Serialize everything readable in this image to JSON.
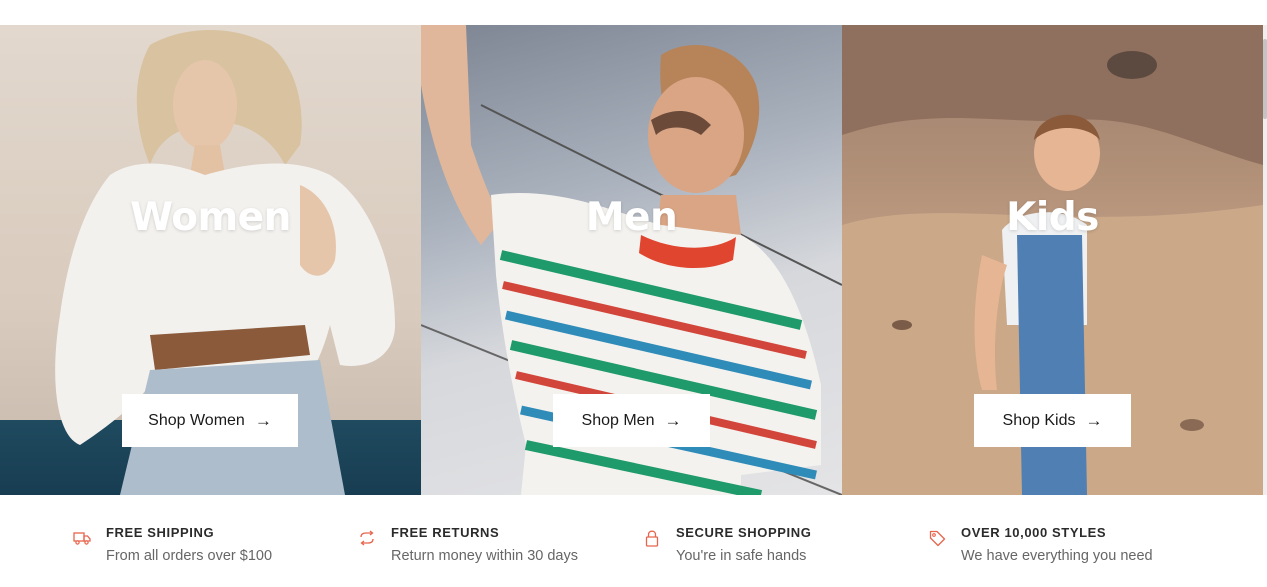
{
  "categories": [
    {
      "title": "Women",
      "button_label": "Shop Women",
      "arrow": "→"
    },
    {
      "title": "Men",
      "button_label": "Shop Men",
      "arrow": "→"
    },
    {
      "title": "Kids",
      "button_label": "Shop Kids",
      "arrow": "→"
    }
  ],
  "features": [
    {
      "icon": "truck-icon",
      "title": "FREE SHIPPING",
      "description": "From all orders over $100"
    },
    {
      "icon": "returns-icon",
      "title": "FREE RETURNS",
      "description": "Return money within 30 days"
    },
    {
      "icon": "lock-icon",
      "title": "SECURE SHOPPING",
      "description": "You're in safe hands"
    },
    {
      "icon": "tag-icon",
      "title": "OVER 10,000 STYLES",
      "description": "We have everything you need"
    }
  ],
  "colors": {
    "accent": "#e8644c",
    "button_bg": "#ffffff",
    "title_text": "#ffffff"
  }
}
